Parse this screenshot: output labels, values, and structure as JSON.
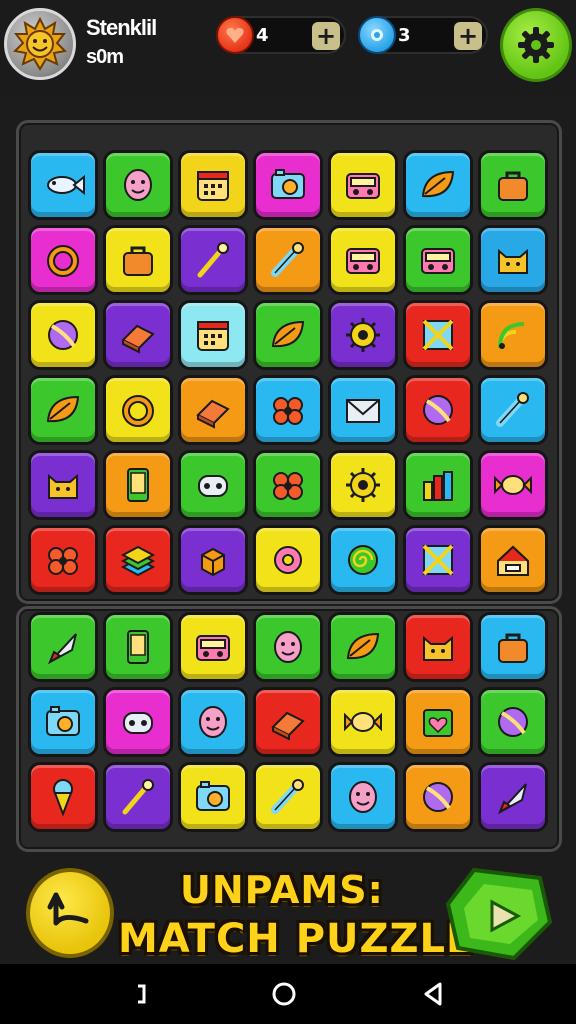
{
  "player": {
    "name": "Stenklil",
    "subtitle": "s0m"
  },
  "resources": [
    {
      "id": "hearts",
      "value": "4",
      "icon": "heart-gem-icon",
      "color": "#e8341a"
    },
    {
      "id": "gems",
      "value": "3",
      "icon": "blue-gem-icon",
      "color": "#2aa4e8"
    }
  ],
  "plus_label": "+",
  "title": {
    "line1": "UNPAMS:",
    "line2": "MATCH PUZZLE"
  },
  "colors": {
    "accent": "#ffd21a",
    "settings": "#62c414",
    "board": "#2a2a2a"
  },
  "boards": {
    "top": [
      [
        {
          "c": "#29b8f0",
          "i": "fish"
        },
        {
          "c": "#3cc82c",
          "i": "face"
        },
        {
          "c": "#f2d51a",
          "i": "calendar"
        },
        {
          "c": "#e92ed0",
          "i": "camera"
        },
        {
          "c": "#f2e21a",
          "i": "radio"
        },
        {
          "c": "#29b8f0",
          "i": "leaf"
        },
        {
          "c": "#3cc82c",
          "i": "bag"
        }
      ],
      [
        {
          "c": "#e92ed0",
          "i": "ring"
        },
        {
          "c": "#f2e21a",
          "i": "bag"
        },
        {
          "c": "#7a2fd0",
          "i": "wand"
        },
        {
          "c": "#f49a14",
          "i": "tool"
        },
        {
          "c": "#f2e21a",
          "i": "radio"
        },
        {
          "c": "#3cc82c",
          "i": "radio"
        },
        {
          "c": "#29a8e8",
          "i": "cat"
        }
      ],
      [
        {
          "c": "#f2e21a",
          "i": "ball"
        },
        {
          "c": "#7a2fd0",
          "i": "box"
        },
        {
          "c": "#8ee8f2",
          "i": "calendar"
        },
        {
          "c": "#3cc82c",
          "i": "leaf"
        },
        {
          "c": "#7a2fd0",
          "i": "gear"
        },
        {
          "c": "#e8281e",
          "i": "cross"
        },
        {
          "c": "#f49a14",
          "i": "wifi"
        }
      ],
      [
        {
          "c": "#3cc82c",
          "i": "leaf"
        },
        {
          "c": "#f2e21a",
          "i": "ring"
        },
        {
          "c": "#f49a14",
          "i": "box"
        },
        {
          "c": "#29b8f0",
          "i": "flower"
        },
        {
          "c": "#29b8f0",
          "i": "mail"
        },
        {
          "c": "#e8281e",
          "i": "ball"
        },
        {
          "c": "#29b8f0",
          "i": "tool"
        }
      ],
      [
        {
          "c": "#7a2fd0",
          "i": "cat"
        },
        {
          "c": "#f49a14",
          "i": "phone"
        },
        {
          "c": "#3cc82c",
          "i": "dice"
        },
        {
          "c": "#3cc82c",
          "i": "flower"
        },
        {
          "c": "#f2e21a",
          "i": "gear"
        },
        {
          "c": "#3cc82c",
          "i": "bars"
        },
        {
          "c": "#e92ed0",
          "i": "candy"
        }
      ],
      [
        {
          "c": "#e8281e",
          "i": "flower"
        },
        {
          "c": "#e8281e",
          "i": "stack"
        },
        {
          "c": "#7a2fd0",
          "i": "cube"
        },
        {
          "c": "#f2e21a",
          "i": "donut"
        },
        {
          "c": "#29b8f0",
          "i": "swirl"
        },
        {
          "c": "#7a2fd0",
          "i": "cross"
        },
        {
          "c": "#f49a14",
          "i": "house"
        }
      ]
    ],
    "bottom": [
      [
        {
          "c": "#3cc82c",
          "i": "rocket"
        },
        {
          "c": "#3cc82c",
          "i": "phone"
        },
        {
          "c": "#f2e21a",
          "i": "radio"
        },
        {
          "c": "#3cc82c",
          "i": "face"
        },
        {
          "c": "#3cc82c",
          "i": "leaf"
        },
        {
          "c": "#e8281e",
          "i": "cat"
        },
        {
          "c": "#29b8f0",
          "i": "bag"
        }
      ],
      [
        {
          "c": "#29b8f0",
          "i": "camera"
        },
        {
          "c": "#e92ed0",
          "i": "dice"
        },
        {
          "c": "#29b8f0",
          "i": "face"
        },
        {
          "c": "#e8281e",
          "i": "box"
        },
        {
          "c": "#f2e21a",
          "i": "candy"
        },
        {
          "c": "#f49a14",
          "i": "heart"
        },
        {
          "c": "#3cc82c",
          "i": "ball"
        }
      ],
      [
        {
          "c": "#e8281e",
          "i": "cone"
        },
        {
          "c": "#7a2fd0",
          "i": "wand"
        },
        {
          "c": "#f2e21a",
          "i": "camera"
        },
        {
          "c": "#f2e21a",
          "i": "tool"
        },
        {
          "c": "#29b8f0",
          "i": "face"
        },
        {
          "c": "#f49a14",
          "i": "ball"
        },
        {
          "c": "#7a2fd0",
          "i": "rocket"
        }
      ]
    ]
  }
}
